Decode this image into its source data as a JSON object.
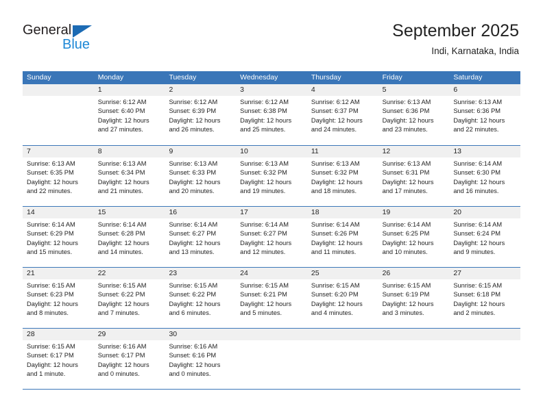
{
  "brand": {
    "word_one": "General",
    "word_two": "Blue",
    "triangle_icon": "triangle-icon",
    "color_dark": "#231f20",
    "color_blue": "#1c87d6",
    "color_triangle": "#1c6bb4"
  },
  "header": {
    "title": "September 2025",
    "location": "Indi, Karnataka, India"
  },
  "theme": {
    "header_blue": "#3a76b8",
    "number_band_gray": "#f0f0f0",
    "text": "#222222"
  },
  "weekdays": [
    "Sunday",
    "Monday",
    "Tuesday",
    "Wednesday",
    "Thursday",
    "Friday",
    "Saturday"
  ],
  "weeks": [
    [
      {
        "day": "",
        "lines": []
      },
      {
        "day": "1",
        "lines": [
          "Sunrise: 6:12 AM",
          "Sunset: 6:40 PM",
          "Daylight: 12 hours",
          "and 27 minutes."
        ]
      },
      {
        "day": "2",
        "lines": [
          "Sunrise: 6:12 AM",
          "Sunset: 6:39 PM",
          "Daylight: 12 hours",
          "and 26 minutes."
        ]
      },
      {
        "day": "3",
        "lines": [
          "Sunrise: 6:12 AM",
          "Sunset: 6:38 PM",
          "Daylight: 12 hours",
          "and 25 minutes."
        ]
      },
      {
        "day": "4",
        "lines": [
          "Sunrise: 6:12 AM",
          "Sunset: 6:37 PM",
          "Daylight: 12 hours",
          "and 24 minutes."
        ]
      },
      {
        "day": "5",
        "lines": [
          "Sunrise: 6:13 AM",
          "Sunset: 6:36 PM",
          "Daylight: 12 hours",
          "and 23 minutes."
        ]
      },
      {
        "day": "6",
        "lines": [
          "Sunrise: 6:13 AM",
          "Sunset: 6:36 PM",
          "Daylight: 12 hours",
          "and 22 minutes."
        ]
      }
    ],
    [
      {
        "day": "7",
        "lines": [
          "Sunrise: 6:13 AM",
          "Sunset: 6:35 PM",
          "Daylight: 12 hours",
          "and 22 minutes."
        ]
      },
      {
        "day": "8",
        "lines": [
          "Sunrise: 6:13 AM",
          "Sunset: 6:34 PM",
          "Daylight: 12 hours",
          "and 21 minutes."
        ]
      },
      {
        "day": "9",
        "lines": [
          "Sunrise: 6:13 AM",
          "Sunset: 6:33 PM",
          "Daylight: 12 hours",
          "and 20 minutes."
        ]
      },
      {
        "day": "10",
        "lines": [
          "Sunrise: 6:13 AM",
          "Sunset: 6:32 PM",
          "Daylight: 12 hours",
          "and 19 minutes."
        ]
      },
      {
        "day": "11",
        "lines": [
          "Sunrise: 6:13 AM",
          "Sunset: 6:32 PM",
          "Daylight: 12 hours",
          "and 18 minutes."
        ]
      },
      {
        "day": "12",
        "lines": [
          "Sunrise: 6:13 AM",
          "Sunset: 6:31 PM",
          "Daylight: 12 hours",
          "and 17 minutes."
        ]
      },
      {
        "day": "13",
        "lines": [
          "Sunrise: 6:14 AM",
          "Sunset: 6:30 PM",
          "Daylight: 12 hours",
          "and 16 minutes."
        ]
      }
    ],
    [
      {
        "day": "14",
        "lines": [
          "Sunrise: 6:14 AM",
          "Sunset: 6:29 PM",
          "Daylight: 12 hours",
          "and 15 minutes."
        ]
      },
      {
        "day": "15",
        "lines": [
          "Sunrise: 6:14 AM",
          "Sunset: 6:28 PM",
          "Daylight: 12 hours",
          "and 14 minutes."
        ]
      },
      {
        "day": "16",
        "lines": [
          "Sunrise: 6:14 AM",
          "Sunset: 6:27 PM",
          "Daylight: 12 hours",
          "and 13 minutes."
        ]
      },
      {
        "day": "17",
        "lines": [
          "Sunrise: 6:14 AM",
          "Sunset: 6:27 PM",
          "Daylight: 12 hours",
          "and 12 minutes."
        ]
      },
      {
        "day": "18",
        "lines": [
          "Sunrise: 6:14 AM",
          "Sunset: 6:26 PM",
          "Daylight: 12 hours",
          "and 11 minutes."
        ]
      },
      {
        "day": "19",
        "lines": [
          "Sunrise: 6:14 AM",
          "Sunset: 6:25 PM",
          "Daylight: 12 hours",
          "and 10 minutes."
        ]
      },
      {
        "day": "20",
        "lines": [
          "Sunrise: 6:14 AM",
          "Sunset: 6:24 PM",
          "Daylight: 12 hours",
          "and 9 minutes."
        ]
      }
    ],
    [
      {
        "day": "21",
        "lines": [
          "Sunrise: 6:15 AM",
          "Sunset: 6:23 PM",
          "Daylight: 12 hours",
          "and 8 minutes."
        ]
      },
      {
        "day": "22",
        "lines": [
          "Sunrise: 6:15 AM",
          "Sunset: 6:22 PM",
          "Daylight: 12 hours",
          "and 7 minutes."
        ]
      },
      {
        "day": "23",
        "lines": [
          "Sunrise: 6:15 AM",
          "Sunset: 6:22 PM",
          "Daylight: 12 hours",
          "and 6 minutes."
        ]
      },
      {
        "day": "24",
        "lines": [
          "Sunrise: 6:15 AM",
          "Sunset: 6:21 PM",
          "Daylight: 12 hours",
          "and 5 minutes."
        ]
      },
      {
        "day": "25",
        "lines": [
          "Sunrise: 6:15 AM",
          "Sunset: 6:20 PM",
          "Daylight: 12 hours",
          "and 4 minutes."
        ]
      },
      {
        "day": "26",
        "lines": [
          "Sunrise: 6:15 AM",
          "Sunset: 6:19 PM",
          "Daylight: 12 hours",
          "and 3 minutes."
        ]
      },
      {
        "day": "27",
        "lines": [
          "Sunrise: 6:15 AM",
          "Sunset: 6:18 PM",
          "Daylight: 12 hours",
          "and 2 minutes."
        ]
      }
    ],
    [
      {
        "day": "28",
        "lines": [
          "Sunrise: 6:15 AM",
          "Sunset: 6:17 PM",
          "Daylight: 12 hours",
          "and 1 minute."
        ]
      },
      {
        "day": "29",
        "lines": [
          "Sunrise: 6:16 AM",
          "Sunset: 6:17 PM",
          "Daylight: 12 hours",
          "and 0 minutes."
        ]
      },
      {
        "day": "30",
        "lines": [
          "Sunrise: 6:16 AM",
          "Sunset: 6:16 PM",
          "Daylight: 12 hours",
          "and 0 minutes."
        ]
      },
      {
        "day": "",
        "lines": []
      },
      {
        "day": "",
        "lines": []
      },
      {
        "day": "",
        "lines": []
      },
      {
        "day": "",
        "lines": []
      }
    ]
  ]
}
